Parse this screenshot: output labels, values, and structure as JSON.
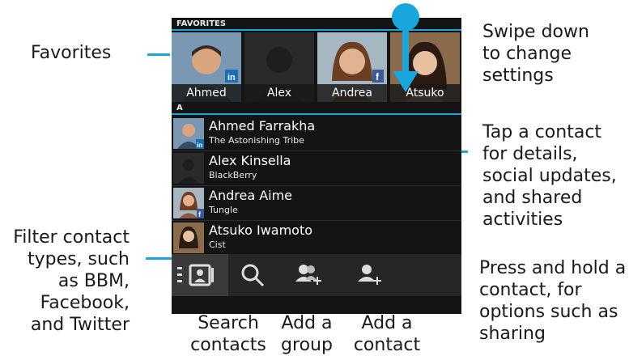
{
  "annotations": {
    "favorites": "Favorites",
    "swipe": [
      "Swipe down",
      "to change",
      "settings"
    ],
    "tap": [
      "Tap a contact",
      "for details,",
      "social updates,",
      "and shared",
      "activities"
    ],
    "filter": [
      "Filter contact",
      "types, such",
      "as BBM,",
      "Facebook,",
      "and Twitter"
    ],
    "press": [
      "Press and hold a",
      "contact, for",
      "options such as",
      "sharing"
    ],
    "search": [
      "Search",
      "contacts"
    ],
    "add_group": [
      "Add a",
      "group"
    ],
    "add_contact": [
      "Add a",
      "contact"
    ]
  },
  "phone": {
    "favorites_header": "FAVORITES",
    "favorites": [
      {
        "name": "Ahmed",
        "badge": "in"
      },
      {
        "name": "Alex",
        "badge": ""
      },
      {
        "name": "Andrea",
        "badge": "f"
      },
      {
        "name": "Atsuko",
        "badge": ""
      }
    ],
    "section_letter": "A",
    "contacts": [
      {
        "name": "Ahmed Farrakha",
        "company": "The Astonishing Tribe",
        "badge": "in"
      },
      {
        "name": "Alex Kinsella",
        "company": "BlackBerry",
        "badge": ""
      },
      {
        "name": "Andrea Aime",
        "company": "Tungle",
        "badge": "f"
      },
      {
        "name": "Atsuko Iwamoto",
        "company": "Cist",
        "badge": ""
      }
    ],
    "toolbar": [
      "contacts-filter-icon",
      "search-icon",
      "add-group-icon",
      "add-contact-icon"
    ]
  },
  "colors": {
    "accent": "#19a6dd",
    "phone_bg": "#141414"
  }
}
